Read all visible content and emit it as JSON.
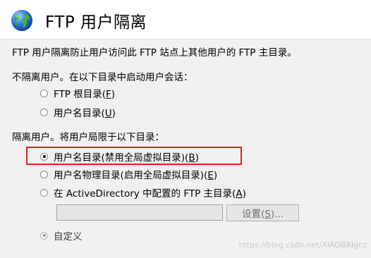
{
  "header": {
    "icon": "globe-icon",
    "title": "FTP 用户隔离"
  },
  "description": "FTP 用户隔离防止用户访问此 FTP 站点上其他用户的 FTP 主目录。",
  "no_isolation": {
    "heading": "不隔离用户。在以下目录中启动用户会话：",
    "options": [
      {
        "label": "FTP 根目录(",
        "key": "F",
        "suffix": ")",
        "checked": false
      },
      {
        "label": "用户名目录(",
        "key": "U",
        "suffix": ")",
        "checked": false
      }
    ]
  },
  "isolation": {
    "heading": "隔离用户。将用户局限于以下目录：",
    "options": [
      {
        "label": "用户名目录(禁用全局虚拟目录)(",
        "key": "B",
        "suffix": ")",
        "checked": true
      },
      {
        "label": "用户名物理目录(启用全局虚拟目录)(",
        "key": "E",
        "suffix": ")",
        "checked": false
      },
      {
        "label": "在 ActiveDirectory 中配置的 FTP 主目录(",
        "key": "A",
        "suffix": ")",
        "checked": false
      }
    ],
    "ad_path_value": "",
    "settings_button": {
      "label": "设置(",
      "key": "S",
      "suffix": ")..."
    },
    "custom_option": {
      "label": "自定义",
      "checked": true,
      "disabled": true
    }
  },
  "colors": {
    "highlight_border": "#e02020",
    "panel_background": "#f0f0f0"
  },
  "watermark": "https://blog.csdn.net/XIAOBAIgcz"
}
